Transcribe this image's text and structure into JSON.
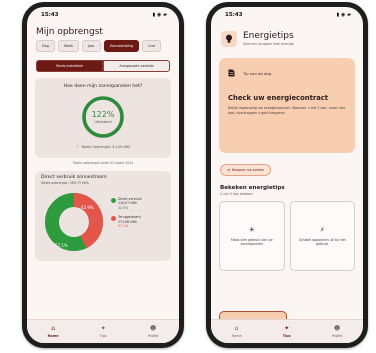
{
  "left_screen": {
    "status": {
      "time": "15:43",
      "icons": "▮ ◉ ▰"
    },
    "title": "Mijn opbrengst",
    "filters": [
      {
        "label": "Dag",
        "active": false
      },
      {
        "label": "Week",
        "active": false
      },
      {
        "label": "Jaar",
        "active": false
      },
      {
        "label": "Zonnestraling",
        "active": true
      },
      {
        "label": "Live",
        "active": false
      }
    ],
    "segments": [
      {
        "label": "Sinds installatie",
        "active": true
      },
      {
        "label": "Aangepaste periode",
        "active": false
      }
    ],
    "efficiency": {
      "title": "Hoe doen mijn zonnepanelen het?",
      "percent": "122%",
      "percent_value": 122,
      "status": "Uitstekend",
      "total": "Totale Opbrengst: 3.149 kWh",
      "updated": "Totale opbrengst sinds 30 maart 2024"
    },
    "direct": {
      "title": "Direct verbruik zonnestroom",
      "subtitle": "Totale opbrengst: 389,73 kWh",
      "percent_direct": "42.9%",
      "percent_returned": "57.1%",
      "value_direct": 42.9,
      "value_returned": 57.1,
      "legend": [
        {
          "label": "Direct verbruik",
          "amount": "116,07 kWh",
          "percent": "42.9%",
          "tone": "green"
        },
        {
          "label": "Teruggeleverd",
          "amount": "273,66 kWh",
          "percent": "57.1%",
          "tone": "red"
        }
      ]
    },
    "nav": [
      {
        "label": "Home",
        "icon": "⌂",
        "active": true
      },
      {
        "label": "Tips",
        "icon": "✦",
        "active": false
      },
      {
        "label": "Profiel",
        "icon": "☻",
        "active": false
      }
    ]
  },
  "right_screen": {
    "status": {
      "time": "15:43",
      "icons": "▮ ◉ ▰"
    },
    "title": "Energietips",
    "subtitle": "Slimmer omgaan met energie",
    "tip_of_day": {
      "label": "Tip van de dag",
      "title": "Check uw energiecontract",
      "body": "Bekijk regelmatig uw energiecontract. Wanneer u het 3 jaar, maar niet laat, overstappen u geld besparen."
    },
    "pill_button": "Bespaar uw kosten",
    "section_title": "Bekeken energietips",
    "section_subtitle": "0 van 5 tips bekeken",
    "tiles": [
      {
        "icon": "☀",
        "text": "Maak slim gebruik van uw zonnepanelen"
      },
      {
        "icon": "⚡",
        "text": "Schakel apparaten uit bij niet gebruik"
      }
    ],
    "nav": [
      {
        "label": "Home",
        "icon": "⌂",
        "active": false
      },
      {
        "label": "Tips",
        "icon": "✦",
        "active": true
      },
      {
        "label": "Profiel",
        "icon": "☻",
        "active": false
      }
    ]
  },
  "colors": {
    "brand": "#6e1a14",
    "good": "#2e8b3b",
    "alert": "#d64a3a",
    "tip_card": "#f8ceb0"
  }
}
